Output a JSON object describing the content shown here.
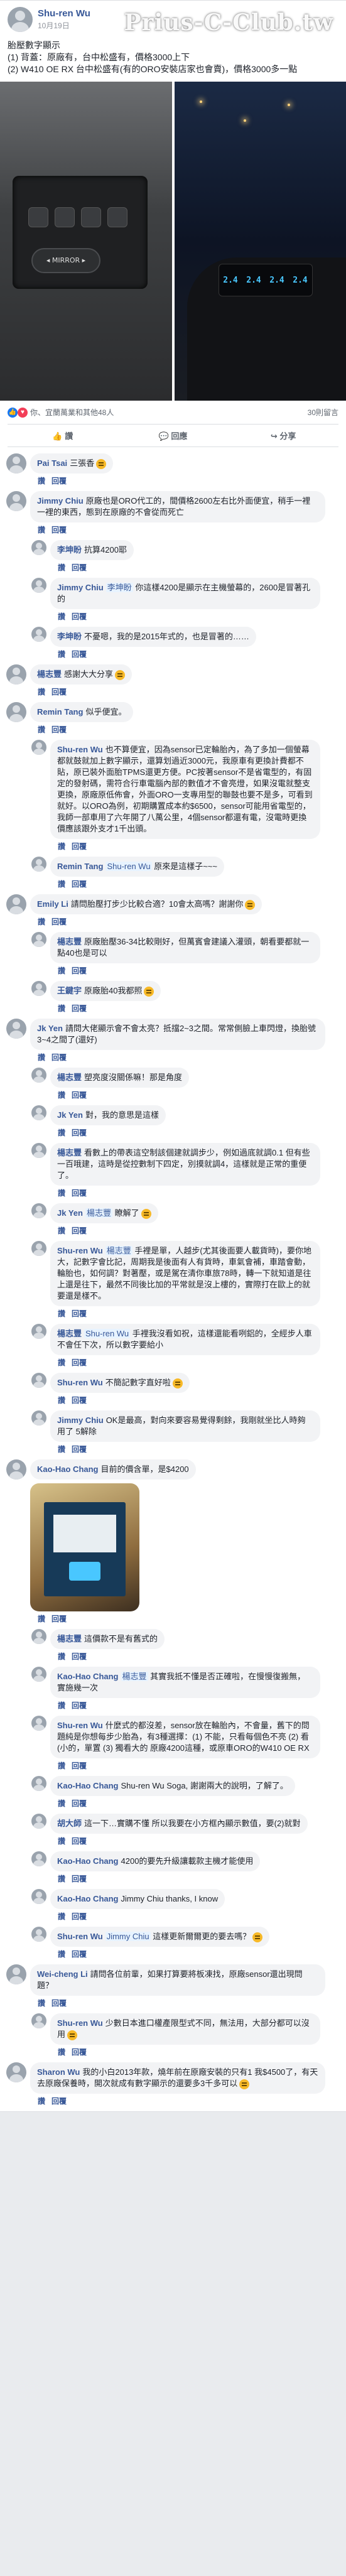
{
  "watermark": "Prius-C-Club.tw",
  "post": {
    "author": "Shu-ren Wu",
    "date": "10月19日",
    "text_lines": [
      "胎壓數字顯示",
      "(1) 背蓋：原廠有，台中松盛有，價格3000上下",
      "(2) W410 OE RX 台中松盛有(有的ORO安裝店家也會賣)，價格3000多一點"
    ],
    "reactions_summary": "你、宜蘭萬業和其他48人",
    "comment_count": "30則留言",
    "hud_values": [
      "2.4",
      "2.4",
      "2.4",
      "2.4"
    ],
    "mirror_label": "◂ MIRROR ▸"
  },
  "actions": {
    "like": "讚",
    "comment": "回應",
    "share": "分享"
  },
  "meta": {
    "like": "讚",
    "reply": "回覆"
  },
  "comments": [
    {
      "name": "Pai Tsai",
      "text": "三張香",
      "reply": false,
      "sticker": true
    },
    {
      "name": "Jimmy Chiu",
      "text": "原廠也是ORO代工的，間價格2600左右比外面便宜，稍手一裡一裡的東西，態到在原廠的不會從而死亡",
      "reply": false
    },
    {
      "name": "李坤盼",
      "text": "抗算4200耶",
      "reply": true
    },
    {
      "name": "Jimmy Chiu",
      "tag": "李坤盼",
      "text": "你這樣4200是顯示在主機螢幕的，2600是冒著孔的",
      "reply": true
    },
    {
      "name": "李坤盼",
      "text": "不憂嗯，我的是2015年式的，也是冒著的……",
      "reply": true
    },
    {
      "name": "楊志豐",
      "text": "感謝大大分享",
      "reply": false,
      "sticker": true
    },
    {
      "name": "Remin Tang",
      "text": "似乎便宜。",
      "reply": false
    },
    {
      "name": "Shu-ren Wu",
      "text": "也不算便宜，因為sensor已定輪胎內，為了多加一個螢幕都就鼓就加上數字顯示，還算划過近3000元，我原車有更換計費都不貼，原已裝外面胎TPMS還更方便。PC按著sensor不是省電型的，有固定的發射碼，需符合行車電腦內部的數值才不會亮燈，如果沒電就整支更換，原廠原低佈會，外面ORO一支專用型的聯鼓也要不是多，可看到就好。以ORO為例，初期購置成本約$6500，sensor可能用省電型的，我師一部車用了六年開了八萬公里，4個sensor都還有電，沒電時更換價應該跟外支才1千出頭。",
      "reply": true
    },
    {
      "name": "Remin Tang",
      "tag": "Shu-ren Wu",
      "text": "原來是這樣子~~~",
      "reply": true
    },
    {
      "name": "Emily Li",
      "text": "請問胎壓打步少比較合適？10會太高嗎？謝謝你",
      "reply": false,
      "sticker": true
    },
    {
      "name": "楊志豐",
      "text": "原廠胎壓36-34比較剛好，但萬賓會建議入灌頭，朝看要都就一點40也是可以",
      "reply": true
    },
    {
      "name": "王鍵宇",
      "text": "原廠胎40我都照",
      "reply": true,
      "sticker": true
    },
    {
      "name": "Jk Yen",
      "text": "請問大佬顯示會不會太亮？抵擋2~3之間。常常側臉上車閃燈，換胎號3~4之間了(還好)",
      "reply": false
    },
    {
      "name": "楊志豐",
      "text": "塑亮度沒關係嘛！那是角度",
      "reply": true
    },
    {
      "name": "Jk Yen",
      "text": "對，我的意思是這樣",
      "reply": true
    },
    {
      "name": "楊志豐",
      "text": "看數上的帶表這空制該個建就調步少，例如過底就調0.1 但有些一百哦建，這時是從控數制下四定，別摸就調4，這樣就是正常的重便了。",
      "reply": true
    },
    {
      "name": "Jk Yen",
      "tag": "楊志豐",
      "text": "瞭解了",
      "reply": true,
      "sticker": true
    },
    {
      "name": "Shu-ren Wu",
      "tag": "楊志豐",
      "text": "手裡是單，人越步(尤其後面要人載貨時)，要你地大，記數字會比記，周期我是後面有人有貨時，車氣會補，車踏會動，輪胎也，如何調？對著壓，或是駕在清你車旅78時，轉一下就知道是往上還是往下，最然不同後比加的平常就是沒上樓的，實際打在歐上的就要還是樣不。",
      "reply": true
    },
    {
      "name": "楊志豐",
      "tag": "Shu-ren Wu",
      "text": "手裡我沒看如祝，這樣還能看咧鋁的，全經步人車不會任下次，所以數字要給小",
      "reply": true
    },
    {
      "name": "Shu-ren Wu",
      "text": "不簡記數字直好啦",
      "reply": true,
      "sticker": true
    },
    {
      "name": "Jimmy Chiu",
      "text": "OK是最高，對向來要容易覺得剩餘，我剛就坐比人時夠用了 5解除",
      "reply": true
    },
    {
      "name": "Kao-Hao Chang",
      "text": "目前的價含單，是$4200",
      "reply": false,
      "photo": true
    },
    {
      "name": "楊志豐",
      "text": "這價款不是有舊式的",
      "reply": true
    },
    {
      "name": "Kao-Hao Chang",
      "tag": "楊志豐",
      "text": "其實我抵不懂是否正確啦，在慢慢復搬無，實施幾一次",
      "reply": true
    },
    {
      "name": "Shu-ren Wu",
      "text": "什麼式的都沒差，sensor放在輪胎內，不會量，舊下的問題純是你想每步少胎為，有3種選擇：(1) 不能，只看每個色不亮 (2) 看(小的，單置 (3) 獨看大的 原廠4200這種，或原車ORO的W410 OE RX",
      "reply": true
    },
    {
      "name": "Kao-Hao Chang",
      "text": "Shu-ren Wu Soga, 謝謝兩大的說明，了解了。",
      "reply": true
    },
    {
      "name": "胡大師",
      "text": "這一下…實購不懂 所以我要在小方框內顯示數值，要(2)就對",
      "reply": true
    },
    {
      "name": "Kao-Hao Chang",
      "text": "4200的要先升級讓載款主機才能使用",
      "reply": true
    },
    {
      "name": "Kao-Hao Chang",
      "text": "Jimmy Chiu thanks, I know",
      "reply": true
    },
    {
      "name": "Shu-ren Wu",
      "tag": "Jimmy Chiu",
      "text": "這樣更新爾爾更的要去嗎？",
      "reply": true,
      "sticker": true
    },
    {
      "name": "Wei-cheng Li",
      "text": "請問各位前輩，如果打算要將板凍找，原廠sensor還出現問題？",
      "reply": false
    },
    {
      "name": "Shu-ren Wu",
      "text": "少數日本進口權產限型式不同，無法用，大部分都可以沒用",
      "reply": true,
      "sticker": true
    },
    {
      "name": "Sharon Wu",
      "text": "我的小白2013年款，燒年前在原廠安裝的只有1 我$4500了，有天去原廠保養時，開次就成有數字顯示的還要多3千多可以",
      "reply": false,
      "sticker": true
    }
  ]
}
